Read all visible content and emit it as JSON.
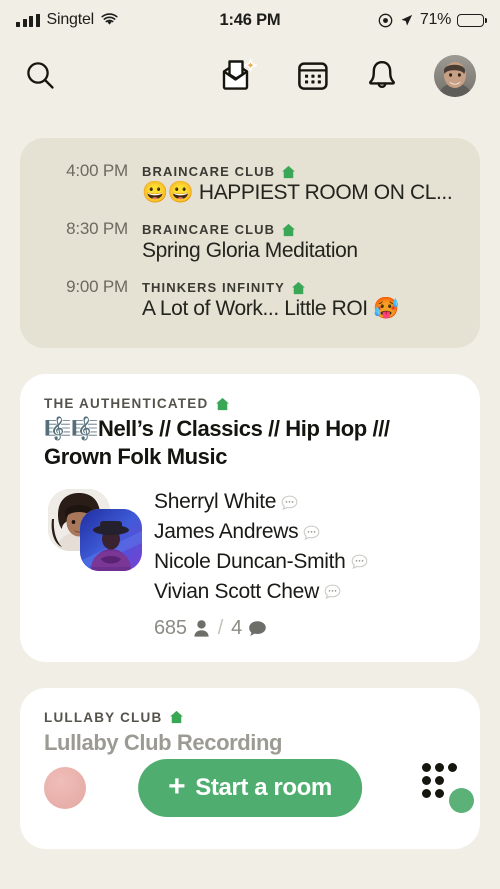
{
  "status_bar": {
    "carrier": "Singtel",
    "time": "1:46 PM",
    "battery_percent": "71%",
    "battery_level": 71,
    "battery_color": "#f5cf3f",
    "icons": [
      "signal-bars-icon",
      "wifi-icon",
      "low-power-icon",
      "location-arrow-icon",
      "battery-icon"
    ]
  },
  "navbar": {
    "search_icon": "search-icon",
    "invite_icon": "invite-envelope-sparkle-icon",
    "calendar_icon": "calendar-icon",
    "notifications_icon": "bell-icon",
    "profile_icon": "profile-avatar"
  },
  "upcoming_events": {
    "background": "#e5e1d3",
    "items": [
      {
        "time": "4:00 PM",
        "club": "BRAINCARE CLUB",
        "club_badge": "house-icon",
        "title": "😀😀 HAPPIEST ROOM ON CL..."
      },
      {
        "time": "8:30 PM",
        "club": "BRAINCARE CLUB",
        "club_badge": "house-icon",
        "title": "Spring Gloria Meditation"
      },
      {
        "time": "9:00 PM",
        "club": "THINKERS INFINITY",
        "club_badge": "house-icon",
        "title": "A Lot of Work... Little ROI 🥵"
      }
    ]
  },
  "rooms": [
    {
      "club": "THE AUTHENTICATED",
      "club_badge": "house-icon",
      "title": "🎼🎼Nell’s // Classics // Hip Hop /// Grown Folk Music",
      "speakers": [
        "Sherryl White",
        "James Andrews",
        "Nicole Duncan-Smith",
        "Vivian Scott Chew"
      ],
      "listener_count": "685",
      "speaker_count": "4",
      "listener_icon": "person-icon",
      "speaker_icon": "speech-bubble-icon",
      "divider": "/"
    },
    {
      "club": "LULLABY CLUB",
      "club_badge": "house-icon",
      "title": "Lullaby Club Recording"
    }
  ],
  "floating": {
    "start_room_label": "Start a room",
    "start_room_plus": "+",
    "start_room_color": "#4fae6f",
    "people_fab_icon": "people-grid-icon",
    "people_fab_accent": "#5bb177"
  }
}
